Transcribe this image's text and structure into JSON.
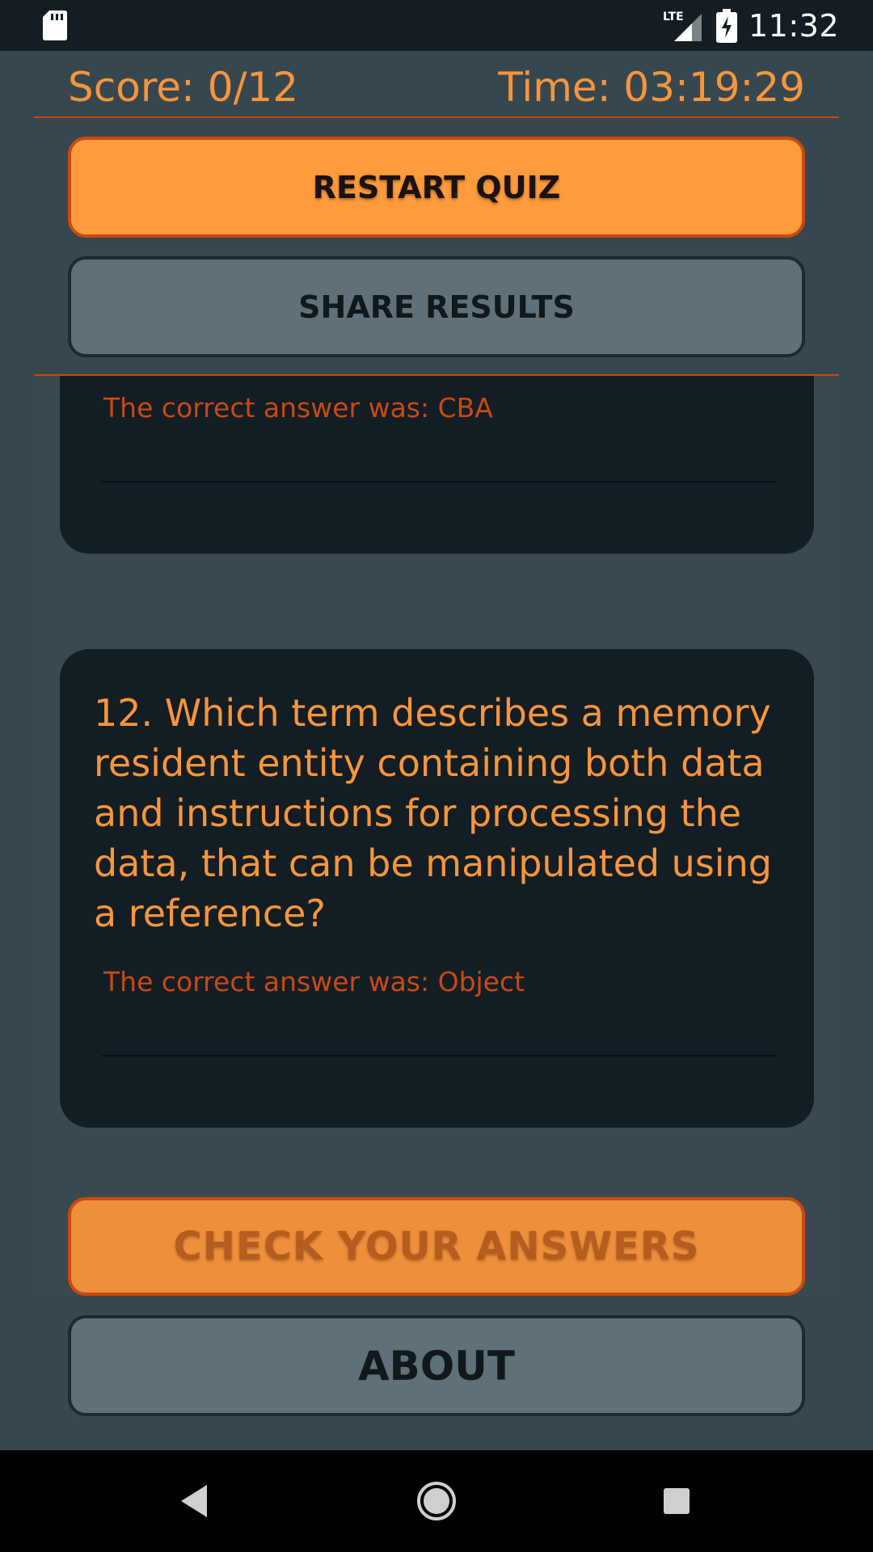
{
  "status_bar": {
    "time": "11:32",
    "network": "LTE",
    "icons": [
      "sd-card-icon",
      "lte-signal-icon",
      "battery-charging-icon"
    ]
  },
  "header": {
    "score": "Score: 0/12",
    "time": "Time: 03:19:29"
  },
  "buttons": {
    "restart": "RESTART QUIZ",
    "share": "SHARE RESULTS",
    "check": "CHECK YOUR ANSWERS",
    "about": "ABOUT"
  },
  "questions": [
    {
      "correct_answer_text": "The correct answer was: CBA"
    },
    {
      "question": "12. Which term describes a memory resident entity containing both data and instructions for processing the data, that can be manipulated using a reference?",
      "correct_answer_text": "The correct answer was: Object"
    }
  ],
  "nav": {
    "icons": [
      "back-icon",
      "home-icon",
      "recents-icon"
    ]
  },
  "colors": {
    "accent": "#f6953b",
    "accent_dark": "#c84a12",
    "background": "#37474f",
    "card": "#131d24",
    "secondary_button": "#607078"
  }
}
